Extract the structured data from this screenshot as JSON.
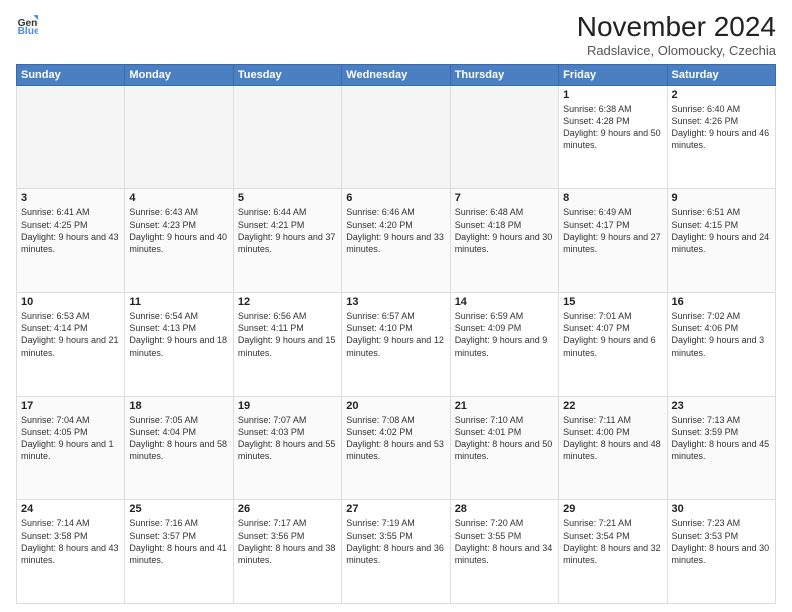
{
  "header": {
    "logo_line1": "General",
    "logo_line2": "Blue",
    "main_title": "November 2024",
    "subtitle": "Radslavice, Olomoucky, Czechia"
  },
  "days_of_week": [
    "Sunday",
    "Monday",
    "Tuesday",
    "Wednesday",
    "Thursday",
    "Friday",
    "Saturday"
  ],
  "weeks": [
    [
      {
        "day": "",
        "info": ""
      },
      {
        "day": "",
        "info": ""
      },
      {
        "day": "",
        "info": ""
      },
      {
        "day": "",
        "info": ""
      },
      {
        "day": "",
        "info": ""
      },
      {
        "day": "1",
        "info": "Sunrise: 6:38 AM\nSunset: 4:28 PM\nDaylight: 9 hours and 50 minutes."
      },
      {
        "day": "2",
        "info": "Sunrise: 6:40 AM\nSunset: 4:26 PM\nDaylight: 9 hours and 46 minutes."
      }
    ],
    [
      {
        "day": "3",
        "info": "Sunrise: 6:41 AM\nSunset: 4:25 PM\nDaylight: 9 hours and 43 minutes."
      },
      {
        "day": "4",
        "info": "Sunrise: 6:43 AM\nSunset: 4:23 PM\nDaylight: 9 hours and 40 minutes."
      },
      {
        "day": "5",
        "info": "Sunrise: 6:44 AM\nSunset: 4:21 PM\nDaylight: 9 hours and 37 minutes."
      },
      {
        "day": "6",
        "info": "Sunrise: 6:46 AM\nSunset: 4:20 PM\nDaylight: 9 hours and 33 minutes."
      },
      {
        "day": "7",
        "info": "Sunrise: 6:48 AM\nSunset: 4:18 PM\nDaylight: 9 hours and 30 minutes."
      },
      {
        "day": "8",
        "info": "Sunrise: 6:49 AM\nSunset: 4:17 PM\nDaylight: 9 hours and 27 minutes."
      },
      {
        "day": "9",
        "info": "Sunrise: 6:51 AM\nSunset: 4:15 PM\nDaylight: 9 hours and 24 minutes."
      }
    ],
    [
      {
        "day": "10",
        "info": "Sunrise: 6:53 AM\nSunset: 4:14 PM\nDaylight: 9 hours and 21 minutes."
      },
      {
        "day": "11",
        "info": "Sunrise: 6:54 AM\nSunset: 4:13 PM\nDaylight: 9 hours and 18 minutes."
      },
      {
        "day": "12",
        "info": "Sunrise: 6:56 AM\nSunset: 4:11 PM\nDaylight: 9 hours and 15 minutes."
      },
      {
        "day": "13",
        "info": "Sunrise: 6:57 AM\nSunset: 4:10 PM\nDaylight: 9 hours and 12 minutes."
      },
      {
        "day": "14",
        "info": "Sunrise: 6:59 AM\nSunset: 4:09 PM\nDaylight: 9 hours and 9 minutes."
      },
      {
        "day": "15",
        "info": "Sunrise: 7:01 AM\nSunset: 4:07 PM\nDaylight: 9 hours and 6 minutes."
      },
      {
        "day": "16",
        "info": "Sunrise: 7:02 AM\nSunset: 4:06 PM\nDaylight: 9 hours and 3 minutes."
      }
    ],
    [
      {
        "day": "17",
        "info": "Sunrise: 7:04 AM\nSunset: 4:05 PM\nDaylight: 9 hours and 1 minute."
      },
      {
        "day": "18",
        "info": "Sunrise: 7:05 AM\nSunset: 4:04 PM\nDaylight: 8 hours and 58 minutes."
      },
      {
        "day": "19",
        "info": "Sunrise: 7:07 AM\nSunset: 4:03 PM\nDaylight: 8 hours and 55 minutes."
      },
      {
        "day": "20",
        "info": "Sunrise: 7:08 AM\nSunset: 4:02 PM\nDaylight: 8 hours and 53 minutes."
      },
      {
        "day": "21",
        "info": "Sunrise: 7:10 AM\nSunset: 4:01 PM\nDaylight: 8 hours and 50 minutes."
      },
      {
        "day": "22",
        "info": "Sunrise: 7:11 AM\nSunset: 4:00 PM\nDaylight: 8 hours and 48 minutes."
      },
      {
        "day": "23",
        "info": "Sunrise: 7:13 AM\nSunset: 3:59 PM\nDaylight: 8 hours and 45 minutes."
      }
    ],
    [
      {
        "day": "24",
        "info": "Sunrise: 7:14 AM\nSunset: 3:58 PM\nDaylight: 8 hours and 43 minutes."
      },
      {
        "day": "25",
        "info": "Sunrise: 7:16 AM\nSunset: 3:57 PM\nDaylight: 8 hours and 41 minutes."
      },
      {
        "day": "26",
        "info": "Sunrise: 7:17 AM\nSunset: 3:56 PM\nDaylight: 8 hours and 38 minutes."
      },
      {
        "day": "27",
        "info": "Sunrise: 7:19 AM\nSunset: 3:55 PM\nDaylight: 8 hours and 36 minutes."
      },
      {
        "day": "28",
        "info": "Sunrise: 7:20 AM\nSunset: 3:55 PM\nDaylight: 8 hours and 34 minutes."
      },
      {
        "day": "29",
        "info": "Sunrise: 7:21 AM\nSunset: 3:54 PM\nDaylight: 8 hours and 32 minutes."
      },
      {
        "day": "30",
        "info": "Sunrise: 7:23 AM\nSunset: 3:53 PM\nDaylight: 8 hours and 30 minutes."
      }
    ]
  ]
}
